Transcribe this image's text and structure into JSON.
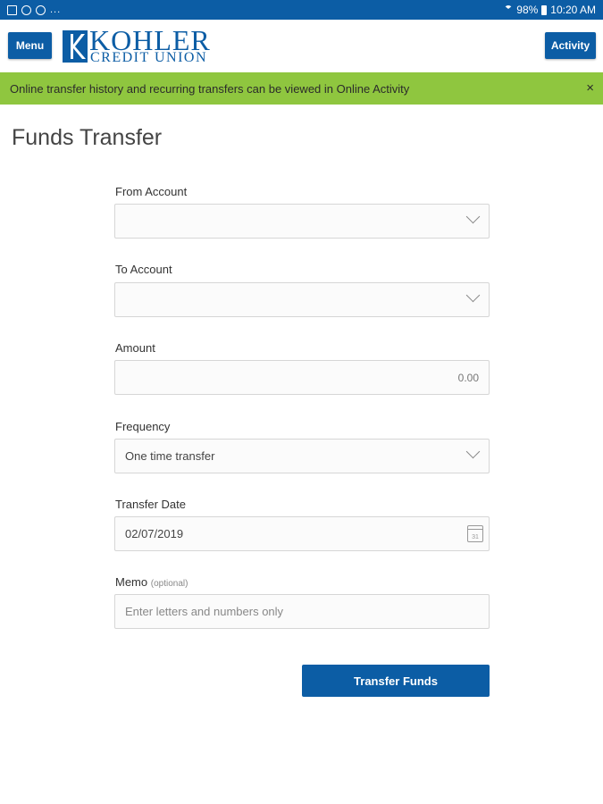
{
  "status_bar": {
    "battery": "98%",
    "time": "10:20 AM",
    "overflow": "..."
  },
  "header": {
    "menu_label": "Menu",
    "activity_label": "Activity",
    "logo_line1": "KOHLER",
    "logo_line2": "CREDIT UNION"
  },
  "banner": {
    "text": "Online transfer history and recurring transfers can be viewed in Online Activity",
    "close_symbol": "×"
  },
  "page": {
    "title": "Funds Transfer"
  },
  "form": {
    "from_account": {
      "label": "From Account",
      "value": ""
    },
    "to_account": {
      "label": "To Account",
      "value": ""
    },
    "amount": {
      "label": "Amount",
      "value": "0.00"
    },
    "frequency": {
      "label": "Frequency",
      "value": "One time transfer"
    },
    "transfer_date": {
      "label": "Transfer Date",
      "value": "02/07/2019",
      "calendar_text": "31"
    },
    "memo": {
      "label": "Memo",
      "optional": "(optional)",
      "placeholder": "Enter letters and numbers only"
    },
    "submit_label": "Transfer Funds"
  },
  "colors": {
    "brand_blue": "#0c5da5",
    "banner_green": "#8fc63f"
  }
}
